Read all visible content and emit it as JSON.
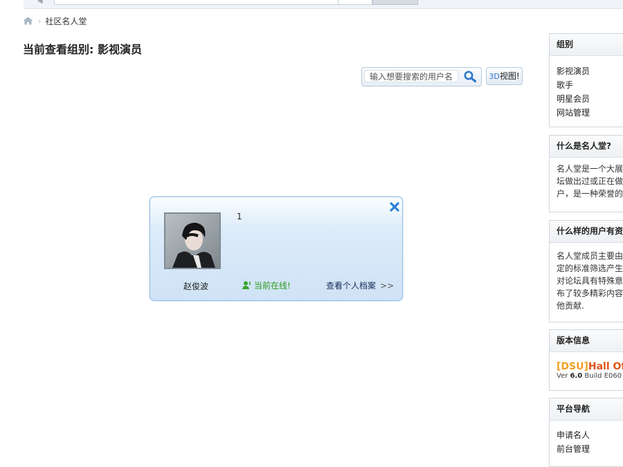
{
  "breadcrumb": {
    "current": "社区名人堂"
  },
  "page": {
    "title": "当前查看组别: 影视演员"
  },
  "search": {
    "placeholder": "输入想要搜索的用户名"
  },
  "view3d": {
    "prefix": "3D",
    "label": "视图!"
  },
  "member_card": {
    "number": "1",
    "username": "赵俊波",
    "status": "当前在线!",
    "profile_link": "查看个人档案",
    "profile_chevron": ">>"
  },
  "sidebar": {
    "groups": {
      "title": "组别",
      "items": [
        "影视演员",
        "歌手",
        "明星会员",
        "网站管理"
      ]
    },
    "what_is": {
      "title": "什么是名人堂?",
      "lines": [
        "名人堂是一个大展",
        "坛做出过或正在做",
        "户，是一种荣誉的"
      ]
    },
    "who": {
      "title": "什么样的用户有资",
      "lines": [
        "名人堂成员主要由",
        "定的标准筛选产生",
        "对论坛具有特殊意",
        "布了较多精彩内容",
        "他贡献."
      ]
    },
    "version": {
      "title": "版本信息",
      "name_bracket": "[DSU]",
      "name_rest": "Hall Of F",
      "ver_prefix": "Ver ",
      "ver_number": "6.0",
      "ver_build": " Build E060"
    },
    "nav": {
      "title": "平台导航",
      "items": [
        "申请名人",
        "前台管理"
      ]
    }
  },
  "colors": {
    "online_green": "#2b9a1c",
    "link_blue": "#2e78c9",
    "dsu_orange": "#f0a020",
    "hof_red": "#e05418"
  }
}
